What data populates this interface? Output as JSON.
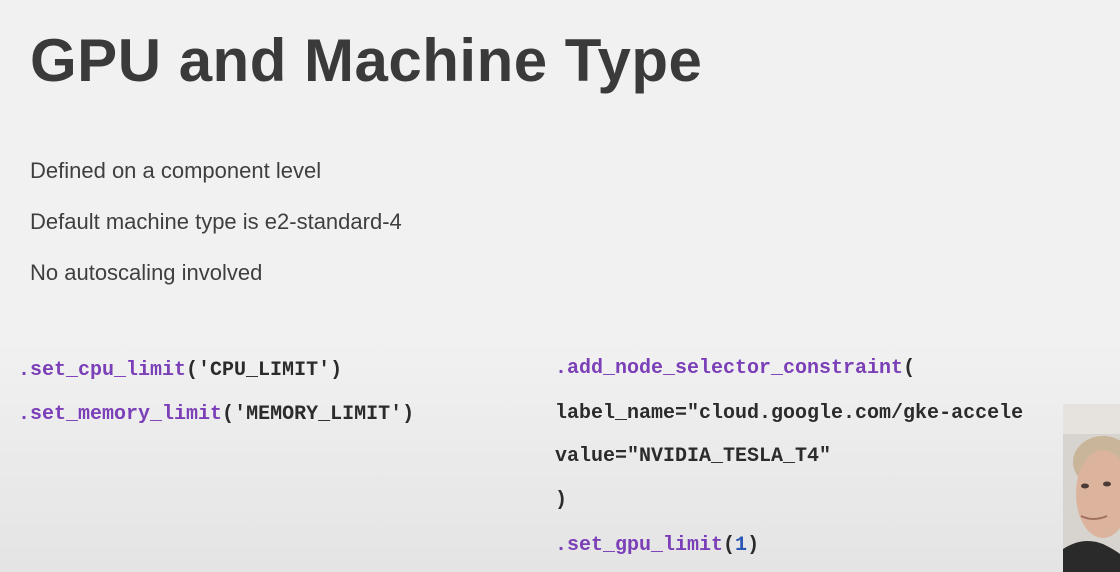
{
  "slide": {
    "title": "GPU and Machine Type",
    "bullets": [
      "Defined on a component level",
      "Default machine type is e2-standard-4",
      "No autoscaling involved"
    ]
  },
  "code_left": [
    {
      "fn": ".set_cpu_limit",
      "open": "(",
      "arg": "'CPU_LIMIT'",
      "close": ")"
    },
    {
      "fn": ".set_memory_limit",
      "open": "(",
      "arg": "'MEMORY_LIMIT'",
      "close": ")"
    }
  ],
  "code_right": {
    "line1_fn": ".add_node_selector_constraint",
    "line1_paren": "(",
    "line2": "label_name=\"cloud.google.com/gke-accele",
    "line3": "value=\"NVIDIA_TESLA_T4\"",
    "line4": ")",
    "line5_fn": ".set_gpu_limit",
    "line5_open": "(",
    "line5_num": "1",
    "line5_close": ")"
  },
  "colors": {
    "function": "#7b3fb8",
    "number": "#2a56b5",
    "title": "#3a3a3a"
  }
}
